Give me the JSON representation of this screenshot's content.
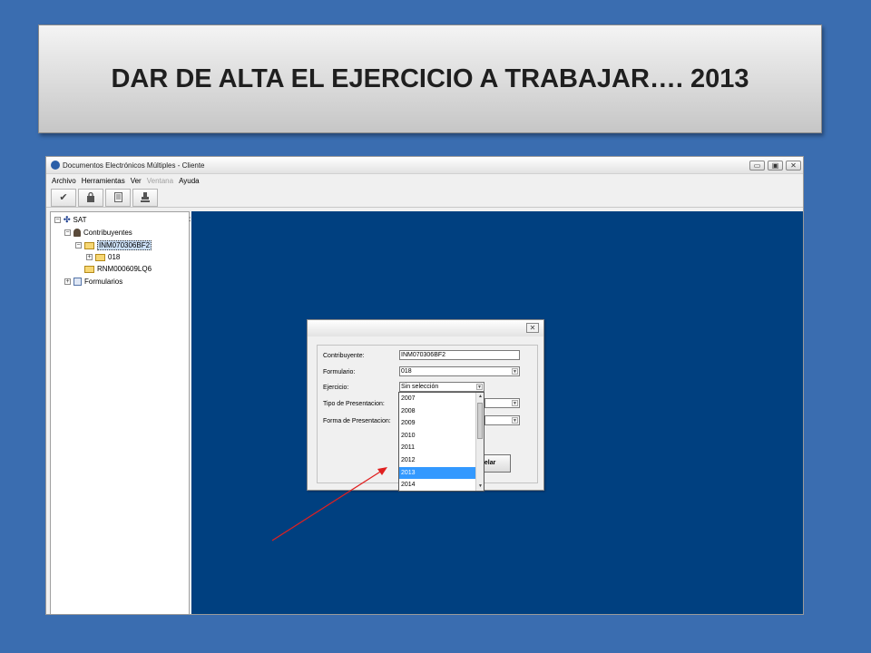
{
  "slide": {
    "title": "DAR DE ALTA EL EJERCICIO A TRABAJAR…. 2013"
  },
  "window": {
    "title": "Documentos Electrónicos Múltiples - Cliente",
    "controls": {
      "minimize": "▭",
      "restore": "▣",
      "close": "✕"
    }
  },
  "menu": {
    "items": [
      {
        "label": "Archivo",
        "enabled": true
      },
      {
        "label": "Herramientas",
        "enabled": true
      },
      {
        "label": "Ver",
        "enabled": true
      },
      {
        "label": "Ventana",
        "enabled": false
      },
      {
        "label": "Ayuda",
        "enabled": true
      }
    ]
  },
  "toolbar": {
    "icons": [
      "check-icon",
      "lock-icon",
      "document-icon",
      "stamp-icon"
    ]
  },
  "tree": {
    "root": "SAT",
    "contribuyentes": "Contribuyentes",
    "rfc_selected": "INM070306BF2",
    "form_folder": "018",
    "rfc_other": "RNM000609LQ6",
    "formularios": "Formularios"
  },
  "dialog": {
    "close": "✕",
    "fields": {
      "contribuyente_label": "Contribuyente:",
      "contribuyente_value": "INM070306BF2",
      "formulario_label": "Formulario:",
      "formulario_value": "018",
      "ejercicio_label": "Ejercicio:",
      "ejercicio_value": "Sin selección",
      "tipo_label": "Tipo de Presentacion:",
      "forma_label": "Forma de Presentacion:"
    },
    "cancel_partial": "celar",
    "dropdown": {
      "options": [
        "2007",
        "2008",
        "2009",
        "2010",
        "2011",
        "2012",
        "2013",
        "2014"
      ],
      "selected": "2013"
    }
  },
  "colors": {
    "slide_background": "#3a6db0",
    "main_pane": "#004080",
    "selection": "#3399ff",
    "annotation_arrow": "#e02020"
  }
}
